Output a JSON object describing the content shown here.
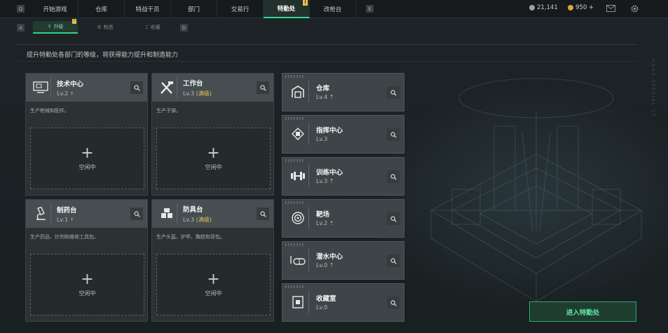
{
  "topbar": {
    "left_key": "Q",
    "right_key": "E",
    "tabs": [
      {
        "label": "开始游戏",
        "active": false
      },
      {
        "label": "仓库",
        "active": false
      },
      {
        "label": "特战干员",
        "active": false
      },
      {
        "label": "部门",
        "active": false
      },
      {
        "label": "交易行",
        "active": false
      },
      {
        "label": "特勤处",
        "active": true,
        "badge": "!"
      },
      {
        "label": "改枪台",
        "active": false
      }
    ],
    "currency_a": "21,141",
    "currency_b": "950 +",
    "icons": [
      "mail-icon",
      "gear-icon"
    ]
  },
  "subtabs": {
    "left_key": "A",
    "right_key": "D",
    "items": [
      {
        "label": "升级",
        "active": true,
        "badge": "!"
      },
      {
        "label": "制造",
        "active": false
      },
      {
        "label": "收藏",
        "active": false
      }
    ]
  },
  "description": "提升特勤处各部门的等级，将获得能力提升和制造能力",
  "workshops": [
    {
      "name": "技术中心",
      "level": "Lv.2",
      "max": "",
      "desc": "生产枪械和配件。",
      "status": "空闲中",
      "icon": "computer-icon"
    },
    {
      "name": "工作台",
      "level": "Lv.3",
      "max": "(满级)",
      "desc": "生产子弹。",
      "status": "空闲中",
      "icon": "tools-icon"
    },
    {
      "name": "制药台",
      "level": "Lv.1",
      "max": "",
      "desc": "生产药品、针剂和维修工具包。",
      "status": "空闲中",
      "icon": "microscope-icon"
    },
    {
      "name": "防具台",
      "level": "Lv.3",
      "max": "(满级)",
      "desc": "生产头盔、护甲、胸挂和背包。",
      "status": "空闲中",
      "icon": "armor-icon"
    }
  ],
  "facilities": [
    {
      "name": "仓库",
      "level": "Lv.4",
      "upgrade": true,
      "icon": "warehouse-icon"
    },
    {
      "name": "指挥中心",
      "level": "Lv.3",
      "upgrade": false,
      "icon": "chip-icon"
    },
    {
      "name": "训练中心",
      "level": "Lv.3",
      "upgrade": true,
      "icon": "dumbbell-icon"
    },
    {
      "name": "靶场",
      "level": "Lv.2",
      "upgrade": true,
      "icon": "target-icon"
    },
    {
      "name": "潜水中心",
      "level": "Lv.0",
      "upgrade": true,
      "icon": "diving-mask-icon"
    },
    {
      "name": "收藏室",
      "level": "Lv.0",
      "upgrade": false,
      "icon": "collection-case-icon"
    }
  ],
  "enter_button": "进入特勤处",
  "side_text": "HOHE SPECIAL 17",
  "colors": {
    "accent": "#34d69a",
    "upgrade": "#e9c35b",
    "coin_a": "#9aa4a8",
    "coin_b": "#d7a63e"
  }
}
